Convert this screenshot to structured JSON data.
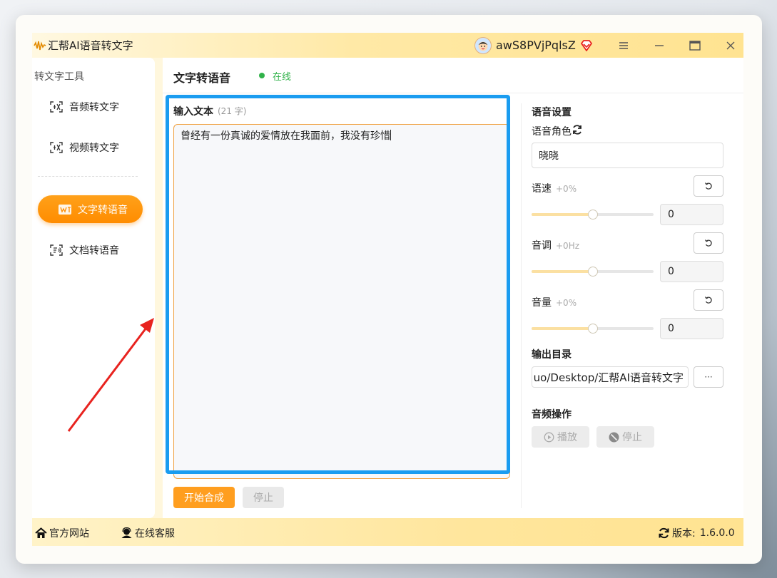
{
  "app": {
    "title": "汇帮AI语音转文字",
    "logo_icon": "audio-wave-logo",
    "username": "awS8PVjPqlsZ",
    "window_controls": [
      "menu-icon",
      "minimize-icon",
      "maximize-icon",
      "close-icon"
    ]
  },
  "sidebar": {
    "heading": "转文字工具",
    "items": [
      {
        "label": "音频转文字",
        "icon": "audio-to-text-icon",
        "active": false
      },
      {
        "label": "视频转文字",
        "icon": "video-to-text-icon",
        "active": false
      },
      {
        "label": "文字转语音",
        "icon": "text-to-speech-icon",
        "active": true
      },
      {
        "label": "文档转语音",
        "icon": "document-to-speech-icon",
        "active": false
      }
    ]
  },
  "main": {
    "title": "文字转语音",
    "status": "在线",
    "status_color": "#31b24a",
    "input_label": "输入文本",
    "char_count": "(21 字)",
    "text_value": "曾经有一份真诚的爱情放在我面前，我没有珍惜",
    "synth_button": "开始合成",
    "stop_button": "停止"
  },
  "settings": {
    "title": "语音设置",
    "voice_label": "语音角色",
    "voice_value": "晓晓",
    "params": [
      {
        "label": "语速",
        "hint": "+0%",
        "value": "0",
        "level": 0.5
      },
      {
        "label": "音调",
        "hint": "+0Hz",
        "value": "0",
        "level": 0.5
      },
      {
        "label": "音量",
        "hint": "+0%",
        "value": "0",
        "level": 0.5
      }
    ],
    "output_title": "输出目录",
    "output_path": "uo/Desktop/汇帮AI语音转文字",
    "browse_label": "···",
    "audio_title": "音频操作",
    "play_label": "播放",
    "audio_stop_label": "停止"
  },
  "footer": {
    "site_link": "官方网站",
    "service_link": "在线客服",
    "version_label": "版本:",
    "version_value": "1.6.0.0"
  },
  "colors": {
    "accent": "#ff9e1f",
    "highlight": "#1a9cf0",
    "arrow": "#e8231f"
  }
}
